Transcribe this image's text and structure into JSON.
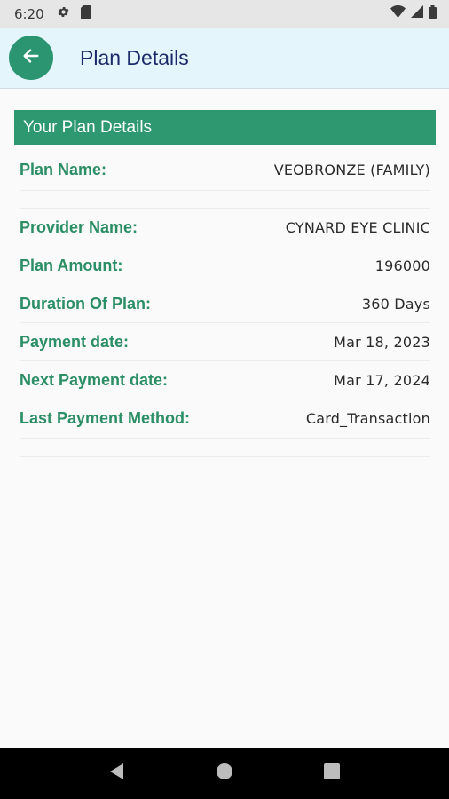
{
  "status_bar": {
    "time": "6:20",
    "icons_left": [
      "gear-icon",
      "sim-card-icon"
    ],
    "icons_right": [
      "wifi-icon",
      "signal-icon",
      "battery-icon"
    ]
  },
  "app_bar": {
    "title": "Plan Details",
    "back_icon": "arrow-left-icon",
    "accent_color": "#2a9570",
    "title_color": "#1b2a6b"
  },
  "section": {
    "title": "Your Plan Details",
    "header_color": "#2e9870"
  },
  "details": [
    {
      "label": "Plan Name:",
      "value": "VEOBRONZE (FAMILY)"
    },
    {
      "label": "Provider Name:",
      "value": "CYNARD EYE CLINIC"
    },
    {
      "label": "Plan Amount:",
      "value": "196000"
    },
    {
      "label": "Duration Of Plan:",
      "value": "360 Days"
    },
    {
      "label": "Payment date:",
      "value": "Mar 18, 2023"
    },
    {
      "label": "Next Payment date:",
      "value": "Mar 17, 2024"
    },
    {
      "label": "Last Payment Method:",
      "value": "Card_Transaction"
    }
  ],
  "nav_bar": {
    "buttons": [
      "back-triangle-icon",
      "home-circle-icon",
      "recents-square-icon"
    ]
  }
}
